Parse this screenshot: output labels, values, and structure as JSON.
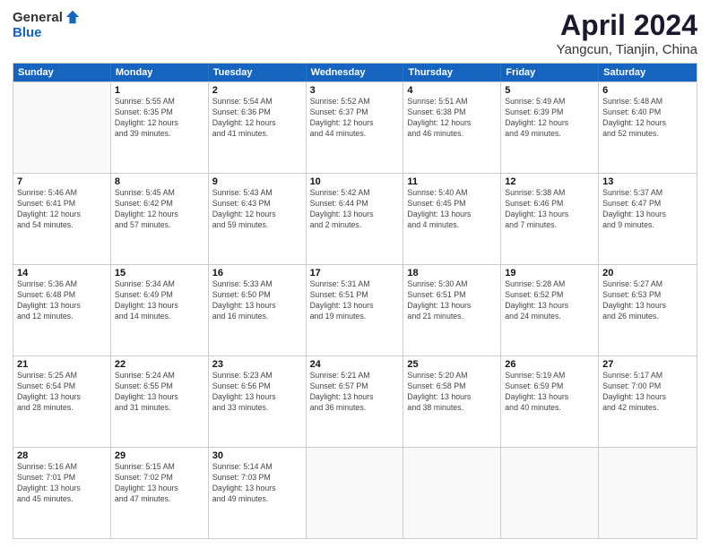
{
  "header": {
    "logo_general": "General",
    "logo_blue": "Blue",
    "month": "April 2024",
    "location": "Yangcun, Tianjin, China"
  },
  "days_of_week": [
    "Sunday",
    "Monday",
    "Tuesday",
    "Wednesday",
    "Thursday",
    "Friday",
    "Saturday"
  ],
  "weeks": [
    [
      {
        "day": "",
        "sunrise": "",
        "sunset": "",
        "daylight": ""
      },
      {
        "day": "1",
        "sunrise": "Sunrise: 5:55 AM",
        "sunset": "Sunset: 6:35 PM",
        "daylight": "Daylight: 12 hours and 39 minutes."
      },
      {
        "day": "2",
        "sunrise": "Sunrise: 5:54 AM",
        "sunset": "Sunset: 6:36 PM",
        "daylight": "Daylight: 12 hours and 41 minutes."
      },
      {
        "day": "3",
        "sunrise": "Sunrise: 5:52 AM",
        "sunset": "Sunset: 6:37 PM",
        "daylight": "Daylight: 12 hours and 44 minutes."
      },
      {
        "day": "4",
        "sunrise": "Sunrise: 5:51 AM",
        "sunset": "Sunset: 6:38 PM",
        "daylight": "Daylight: 12 hours and 46 minutes."
      },
      {
        "day": "5",
        "sunrise": "Sunrise: 5:49 AM",
        "sunset": "Sunset: 6:39 PM",
        "daylight": "Daylight: 12 hours and 49 minutes."
      },
      {
        "day": "6",
        "sunrise": "Sunrise: 5:48 AM",
        "sunset": "Sunset: 6:40 PM",
        "daylight": "Daylight: 12 hours and 52 minutes."
      }
    ],
    [
      {
        "day": "7",
        "sunrise": "Sunrise: 5:46 AM",
        "sunset": "Sunset: 6:41 PM",
        "daylight": "Daylight: 12 hours and 54 minutes."
      },
      {
        "day": "8",
        "sunrise": "Sunrise: 5:45 AM",
        "sunset": "Sunset: 6:42 PM",
        "daylight": "Daylight: 12 hours and 57 minutes."
      },
      {
        "day": "9",
        "sunrise": "Sunrise: 5:43 AM",
        "sunset": "Sunset: 6:43 PM",
        "daylight": "Daylight: 12 hours and 59 minutes."
      },
      {
        "day": "10",
        "sunrise": "Sunrise: 5:42 AM",
        "sunset": "Sunset: 6:44 PM",
        "daylight": "Daylight: 13 hours and 2 minutes."
      },
      {
        "day": "11",
        "sunrise": "Sunrise: 5:40 AM",
        "sunset": "Sunset: 6:45 PM",
        "daylight": "Daylight: 13 hours and 4 minutes."
      },
      {
        "day": "12",
        "sunrise": "Sunrise: 5:38 AM",
        "sunset": "Sunset: 6:46 PM",
        "daylight": "Daylight: 13 hours and 7 minutes."
      },
      {
        "day": "13",
        "sunrise": "Sunrise: 5:37 AM",
        "sunset": "Sunset: 6:47 PM",
        "daylight": "Daylight: 13 hours and 9 minutes."
      }
    ],
    [
      {
        "day": "14",
        "sunrise": "Sunrise: 5:36 AM",
        "sunset": "Sunset: 6:48 PM",
        "daylight": "Daylight: 13 hours and 12 minutes."
      },
      {
        "day": "15",
        "sunrise": "Sunrise: 5:34 AM",
        "sunset": "Sunset: 6:49 PM",
        "daylight": "Daylight: 13 hours and 14 minutes."
      },
      {
        "day": "16",
        "sunrise": "Sunrise: 5:33 AM",
        "sunset": "Sunset: 6:50 PM",
        "daylight": "Daylight: 13 hours and 16 minutes."
      },
      {
        "day": "17",
        "sunrise": "Sunrise: 5:31 AM",
        "sunset": "Sunset: 6:51 PM",
        "daylight": "Daylight: 13 hours and 19 minutes."
      },
      {
        "day": "18",
        "sunrise": "Sunrise: 5:30 AM",
        "sunset": "Sunset: 6:51 PM",
        "daylight": "Daylight: 13 hours and 21 minutes."
      },
      {
        "day": "19",
        "sunrise": "Sunrise: 5:28 AM",
        "sunset": "Sunset: 6:52 PM",
        "daylight": "Daylight: 13 hours and 24 minutes."
      },
      {
        "day": "20",
        "sunrise": "Sunrise: 5:27 AM",
        "sunset": "Sunset: 6:53 PM",
        "daylight": "Daylight: 13 hours and 26 minutes."
      }
    ],
    [
      {
        "day": "21",
        "sunrise": "Sunrise: 5:25 AM",
        "sunset": "Sunset: 6:54 PM",
        "daylight": "Daylight: 13 hours and 28 minutes."
      },
      {
        "day": "22",
        "sunrise": "Sunrise: 5:24 AM",
        "sunset": "Sunset: 6:55 PM",
        "daylight": "Daylight: 13 hours and 31 minutes."
      },
      {
        "day": "23",
        "sunrise": "Sunrise: 5:23 AM",
        "sunset": "Sunset: 6:56 PM",
        "daylight": "Daylight: 13 hours and 33 minutes."
      },
      {
        "day": "24",
        "sunrise": "Sunrise: 5:21 AM",
        "sunset": "Sunset: 6:57 PM",
        "daylight": "Daylight: 13 hours and 36 minutes."
      },
      {
        "day": "25",
        "sunrise": "Sunrise: 5:20 AM",
        "sunset": "Sunset: 6:58 PM",
        "daylight": "Daylight: 13 hours and 38 minutes."
      },
      {
        "day": "26",
        "sunrise": "Sunrise: 5:19 AM",
        "sunset": "Sunset: 6:59 PM",
        "daylight": "Daylight: 13 hours and 40 minutes."
      },
      {
        "day": "27",
        "sunrise": "Sunrise: 5:17 AM",
        "sunset": "Sunset: 7:00 PM",
        "daylight": "Daylight: 13 hours and 42 minutes."
      }
    ],
    [
      {
        "day": "28",
        "sunrise": "Sunrise: 5:16 AM",
        "sunset": "Sunset: 7:01 PM",
        "daylight": "Daylight: 13 hours and 45 minutes."
      },
      {
        "day": "29",
        "sunrise": "Sunrise: 5:15 AM",
        "sunset": "Sunset: 7:02 PM",
        "daylight": "Daylight: 13 hours and 47 minutes."
      },
      {
        "day": "30",
        "sunrise": "Sunrise: 5:14 AM",
        "sunset": "Sunset: 7:03 PM",
        "daylight": "Daylight: 13 hours and 49 minutes."
      },
      {
        "day": "",
        "sunrise": "",
        "sunset": "",
        "daylight": ""
      },
      {
        "day": "",
        "sunrise": "",
        "sunset": "",
        "daylight": ""
      },
      {
        "day": "",
        "sunrise": "",
        "sunset": "",
        "daylight": ""
      },
      {
        "day": "",
        "sunrise": "",
        "sunset": "",
        "daylight": ""
      }
    ]
  ]
}
